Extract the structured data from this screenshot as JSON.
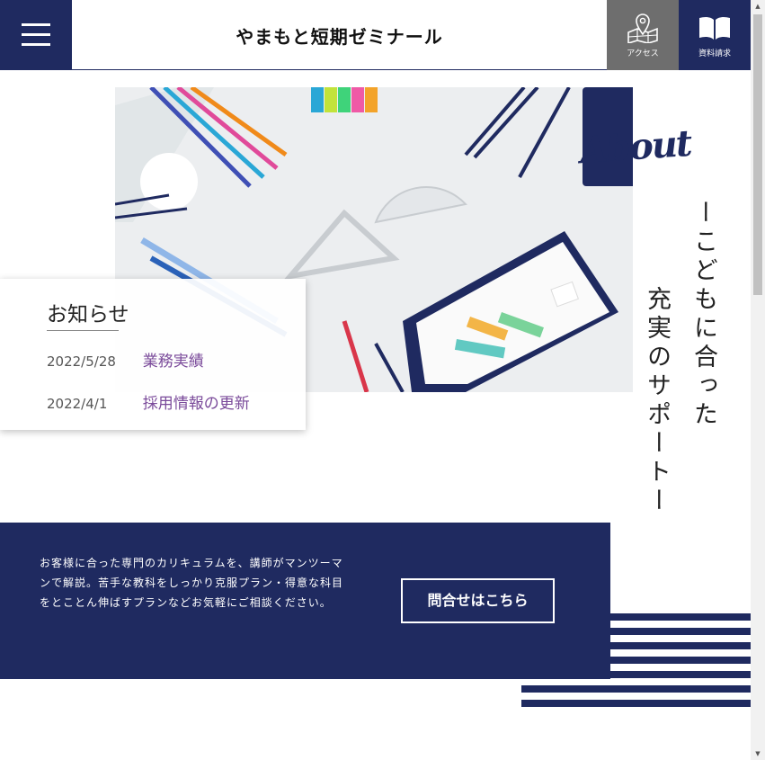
{
  "header": {
    "site_title": "やまもと短期ゼミナール",
    "menu_icon": "hamburger-menu-icon",
    "access": {
      "label": "アクセス",
      "icon": "map-pin-icon"
    },
    "docs": {
      "label": "資料請求",
      "icon": "open-book-icon"
    },
    "colors": {
      "navy": "#1f2a60",
      "gray": "#6e6e6e"
    }
  },
  "hero": {
    "image_subject": "stationery-flatlay-image"
  },
  "about": {
    "script_heading": "About",
    "tagline_line1": "ーこどもに合った",
    "tagline_line2": "充実のサポートー"
  },
  "news": {
    "title": "お知らせ",
    "items": [
      {
        "date": "2022/5/28",
        "label": "業務実績"
      },
      {
        "date": "2022/4/1",
        "label": "採用情報の更新"
      }
    ],
    "link_color": "#7a4a9a"
  },
  "contact": {
    "text": "お客様に合った専門のカリキュラムを、講師がマンツーマンで解説。苦手な教科をしっかり克服プラン・得意な科目をとことん伸ばすプランなどお気軽にご相談ください。",
    "button_label": "問合せはこちら"
  }
}
